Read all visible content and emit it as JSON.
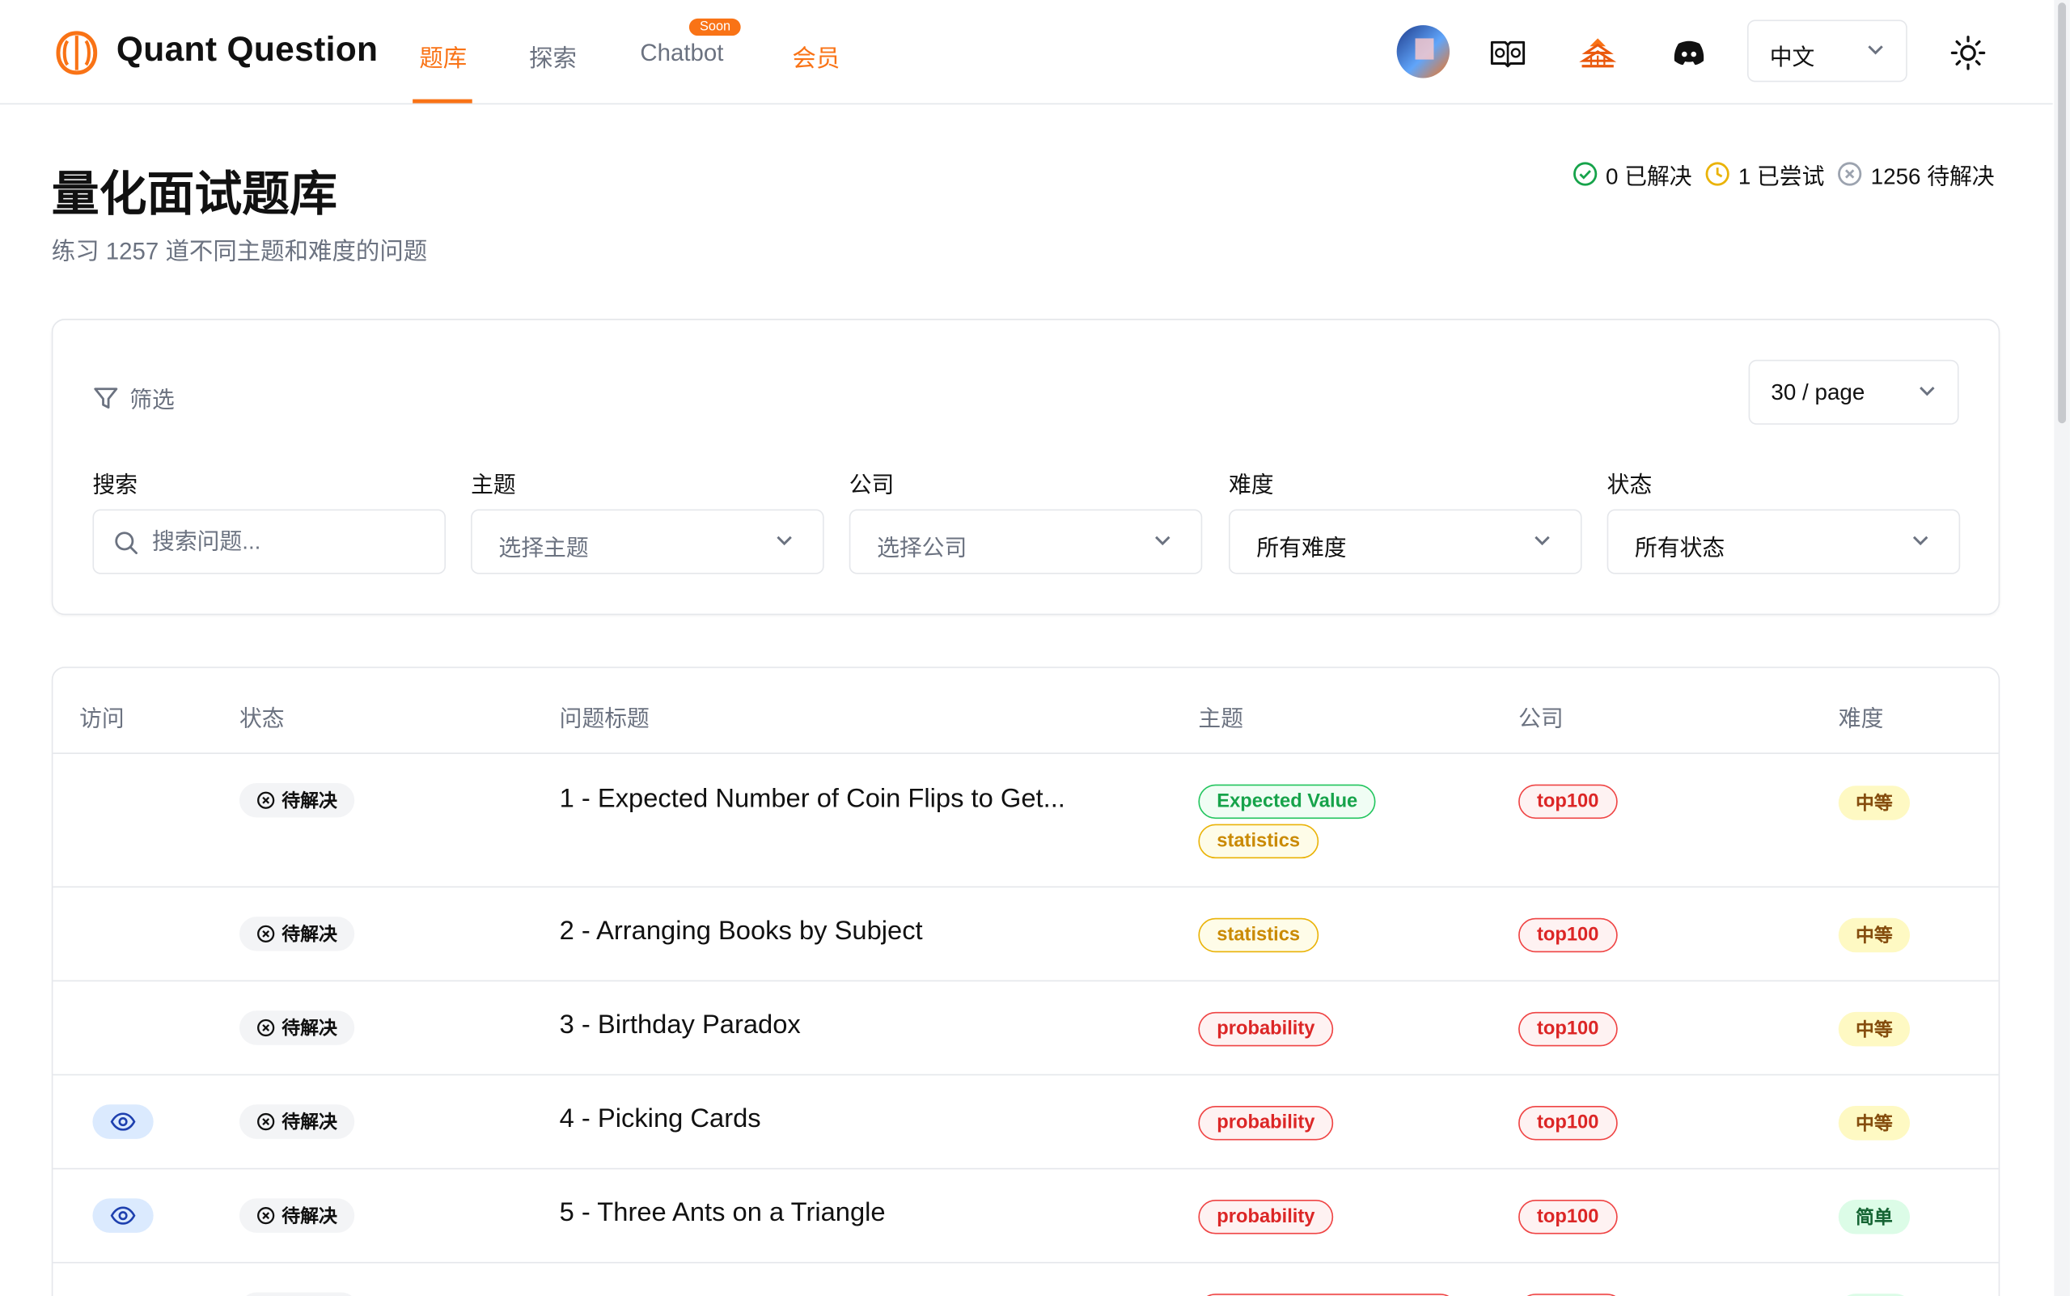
{
  "header": {
    "brand": "Quant Question",
    "nav": [
      {
        "label": "题库",
        "active": true
      },
      {
        "label": "探索",
        "active": false
      },
      {
        "label": "Chatbot",
        "active": false,
        "badge": "Soon"
      },
      {
        "label": "会员",
        "active": false,
        "highlight": true
      }
    ],
    "language": "中文",
    "icons": [
      "avatar",
      "book-icon",
      "pagoda-icon",
      "discord-icon",
      "sun-icon"
    ]
  },
  "page": {
    "title": "量化面试题库",
    "subtitle": "练习 1257 道不同主题和难度的问题",
    "stats": {
      "solved": "0 已解决",
      "attempted": "1 已尝试",
      "unsolved": "1256 待解决"
    }
  },
  "filters": {
    "heading": "筛选",
    "page_size": "30 / page",
    "search": {
      "label": "搜索",
      "placeholder": "搜索问题..."
    },
    "topic": {
      "label": "主题",
      "value": "选择主题"
    },
    "company": {
      "label": "公司",
      "value": "选择公司"
    },
    "difficulty": {
      "label": "难度",
      "value": "所有难度"
    },
    "status": {
      "label": "状态",
      "value": "所有状态"
    }
  },
  "table": {
    "columns": [
      "访问",
      "状态",
      "问题标题",
      "主题",
      "公司",
      "难度"
    ],
    "rows": [
      {
        "visited": false,
        "status": "待解决",
        "title": "1 - Expected Number of Coin Flips to Get...",
        "topics": [
          "Expected Value",
          "statistics"
        ],
        "company": "top100",
        "difficulty": "中等"
      },
      {
        "visited": false,
        "status": "待解决",
        "title": "2 - Arranging Books by Subject",
        "topics": [
          "statistics"
        ],
        "company": "top100",
        "difficulty": "中等"
      },
      {
        "visited": false,
        "status": "待解决",
        "title": "3 - Birthday Paradox",
        "topics": [
          "probability"
        ],
        "company": "top100",
        "difficulty": "中等"
      },
      {
        "visited": true,
        "status": "待解决",
        "title": "4 - Picking Cards",
        "topics": [
          "probability"
        ],
        "company": "top100",
        "difficulty": "中等"
      },
      {
        "visited": true,
        "status": "待解决",
        "title": "5 - Three Ants on a Triangle",
        "topics": [
          "probability"
        ],
        "company": "top100",
        "difficulty": "简单"
      }
    ]
  },
  "colors": {
    "accent": "#f97316",
    "tag_expected_value": "#16a34a",
    "tag_statistics": "#ca8a04",
    "tag_probability": "#dc2626",
    "tag_company": "#dc2626",
    "difficulty_medium_bg": "#fef9c3",
    "difficulty_easy_bg": "#dcfce7"
  }
}
